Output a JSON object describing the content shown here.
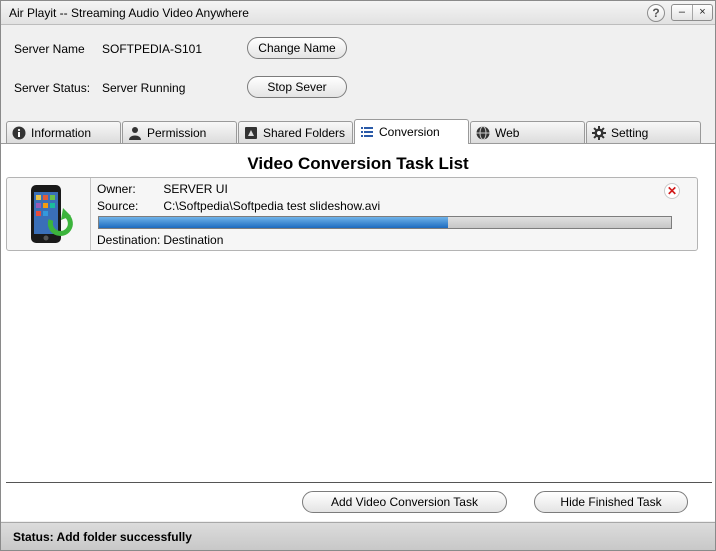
{
  "window": {
    "title": "Air Playit -- Streaming Audio Video Anywhere",
    "help": "?",
    "minimize": "–",
    "close": "×"
  },
  "server": {
    "name_label": "Server Name",
    "name_value": "SOFTPEDIA-S101",
    "change_name_label": "Change Name",
    "status_label": "Server Status:",
    "status_value": "Server Running",
    "stop_label": "Stop Sever"
  },
  "tabs": [
    {
      "label": "Information",
      "icon": "info-icon"
    },
    {
      "label": "Permission",
      "icon": "user-icon"
    },
    {
      "label": "Shared Folders",
      "icon": "folder-icon"
    },
    {
      "label": "Conversion",
      "icon": "list-icon",
      "active": true
    },
    {
      "label": "Web",
      "icon": "globe-icon"
    },
    {
      "label": "Setting",
      "icon": "gear-icon"
    }
  ],
  "conversion": {
    "title": "Video Conversion Task List",
    "task": {
      "owner_label": "Owner:",
      "owner_value": "SERVER UI",
      "source_label": "Source:",
      "source_value": "C:\\Softpedia\\Softpedia test slideshow.avi",
      "destination_label": "Destination:",
      "destination_value": "Destination",
      "progress": 0.61
    },
    "add_task_label": "Add Video Conversion Task",
    "hide_finished_label": "Hide Finished Task"
  },
  "status": {
    "text": "Status:  Add folder successfully"
  },
  "colors": {
    "progress_fill": "#1d6bbf",
    "close_red": "#d11a1a",
    "accent_green": "#3cb43c"
  }
}
